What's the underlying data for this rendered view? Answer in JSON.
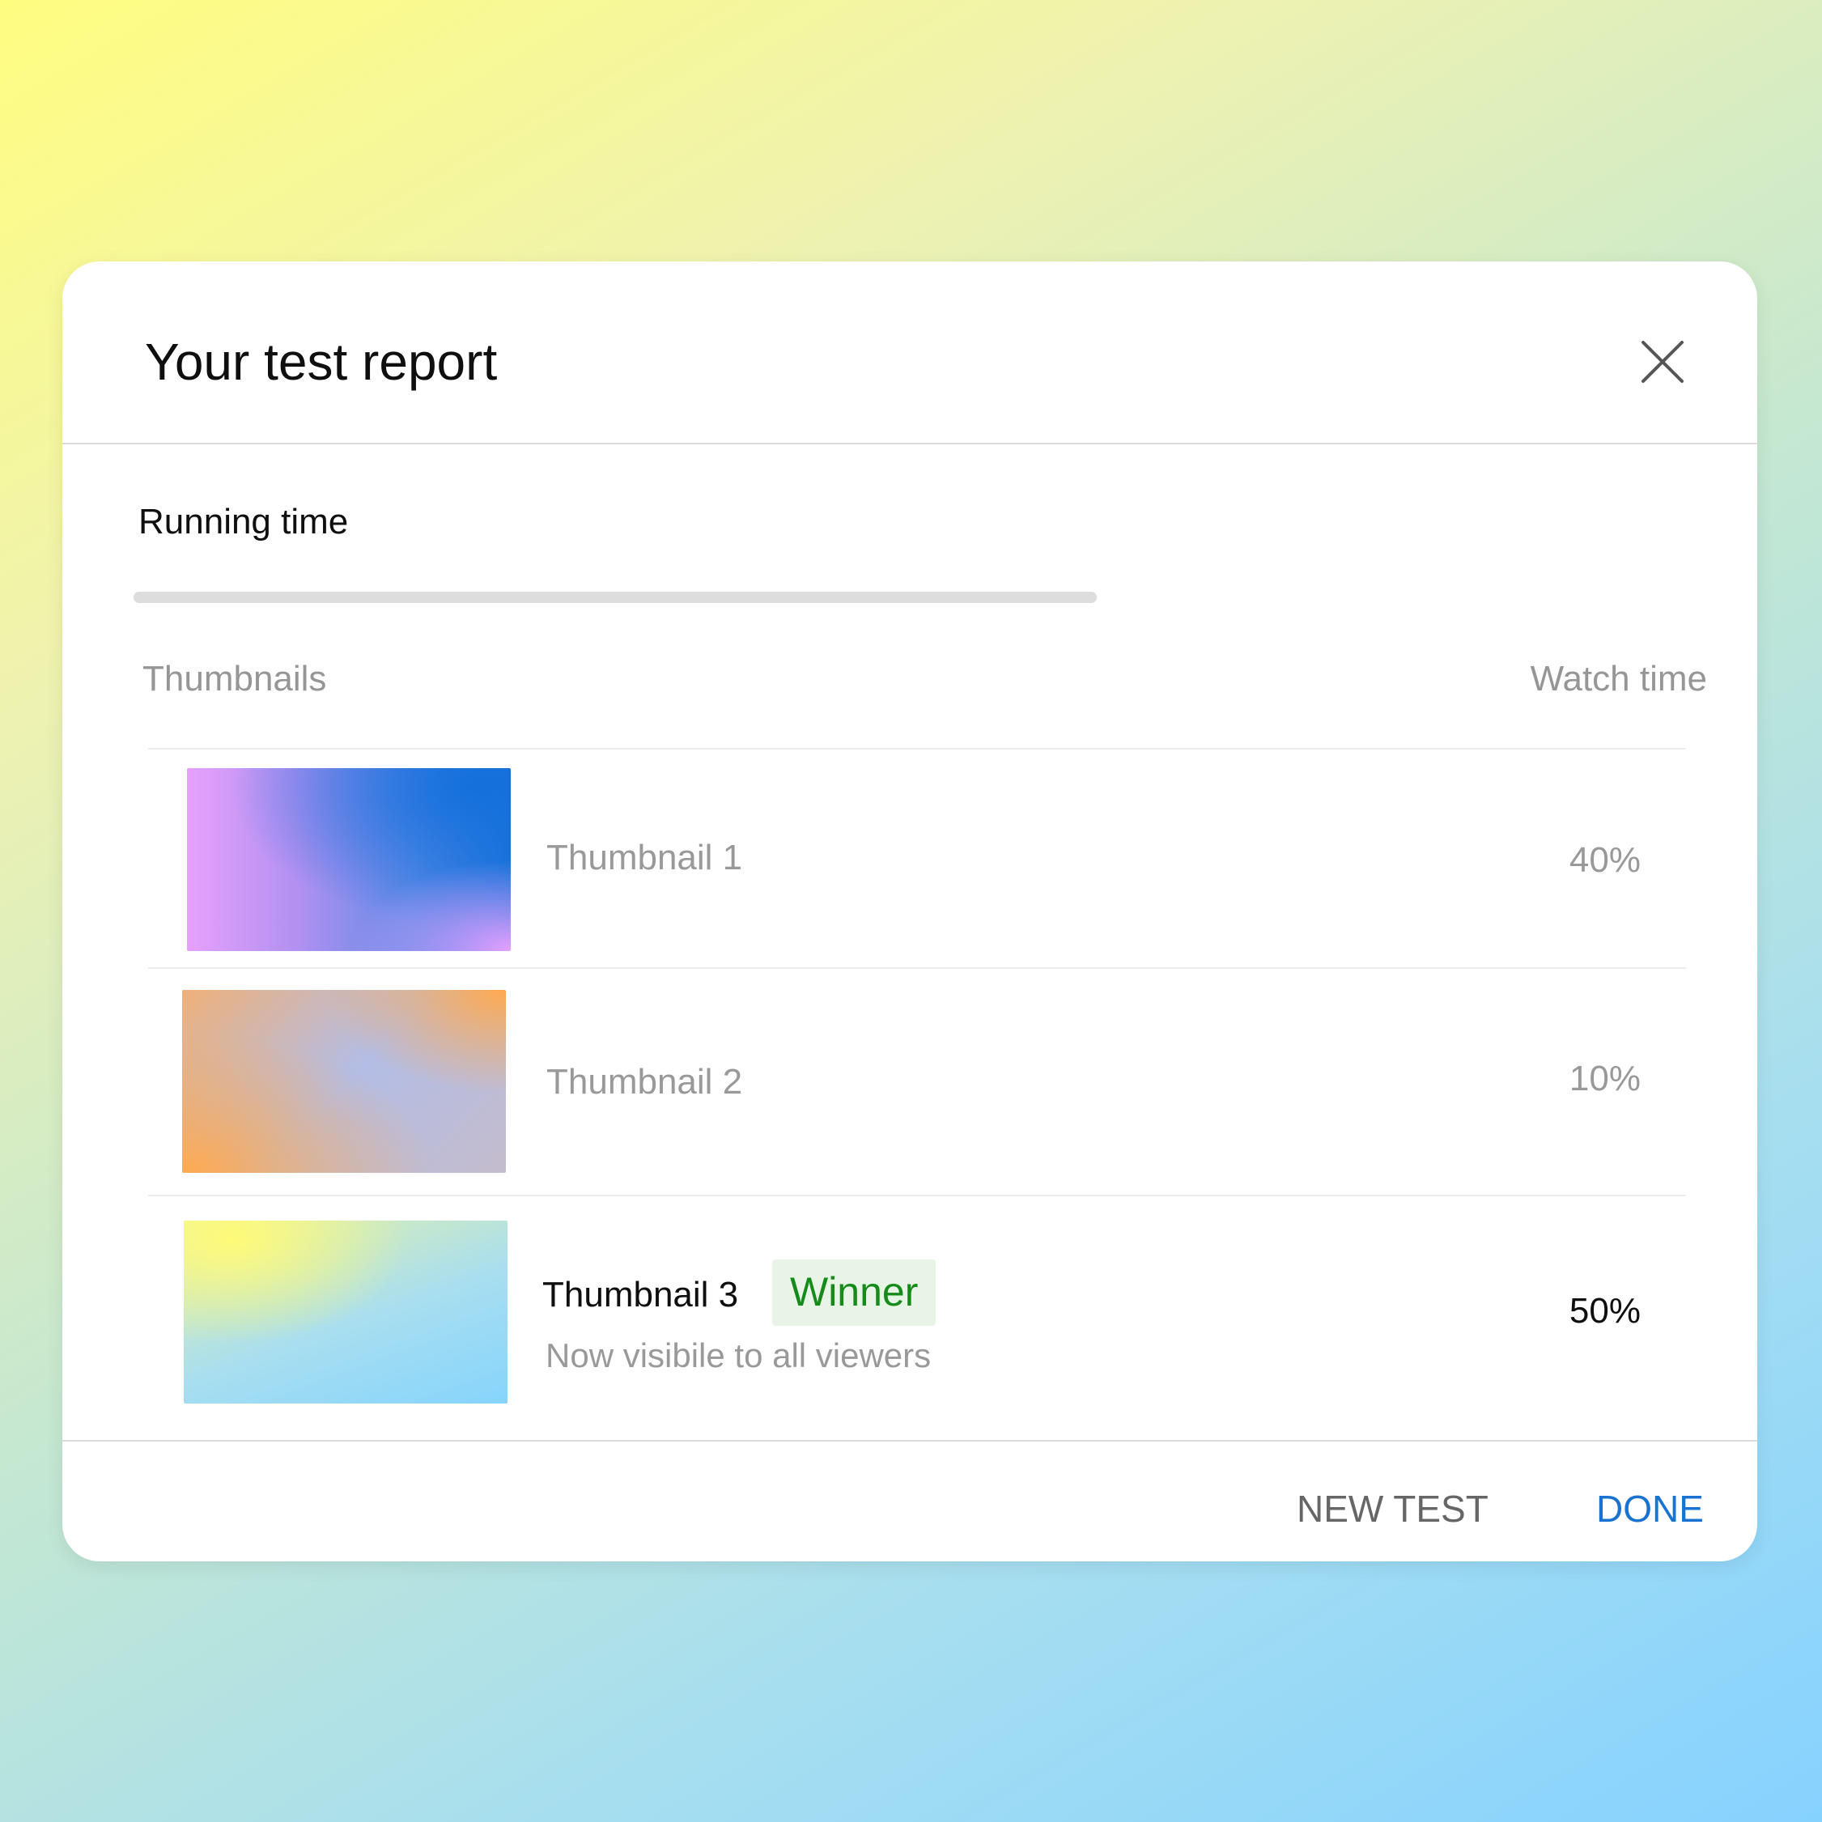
{
  "dialog": {
    "title": "Your test report",
    "close_icon": "close-icon"
  },
  "running_time": {
    "label": "Running time",
    "progress_percent": 100,
    "color": "#dddddd"
  },
  "table": {
    "headers": {
      "thumbnails": "Thumbnails",
      "watch_time": "Watch time"
    },
    "rows": [
      {
        "name": "Thumbnail 1",
        "watch_time": "40%"
      },
      {
        "name": "Thumbnail 2",
        "watch_time": "10%"
      },
      {
        "name": "Thumbnail 3",
        "watch_time": "50%",
        "badge": "Winner",
        "subtext": "Now visibile to all viewers"
      }
    ]
  },
  "footer": {
    "new_test_label": "NEW TEST",
    "done_label": "DONE"
  },
  "colors": {
    "accent_blue": "#1a73d0",
    "winner_green": "#168a1a",
    "winner_badge_bg": "#e8f4e6"
  }
}
